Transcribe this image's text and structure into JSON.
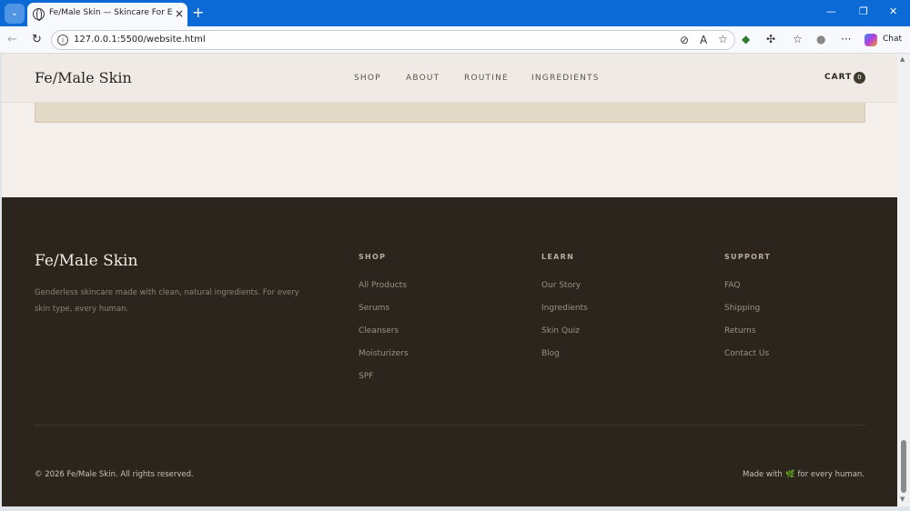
{
  "browser": {
    "tab_title": "Fe/Male Skin — Skincare For Every",
    "new_tab_icon": "plus-icon",
    "url": "127.0.0.1:5500/website.html",
    "chat_label": "Chat",
    "minimize": "—",
    "restore": "❐",
    "close": "✕"
  },
  "site": {
    "logo": "Fe/Male Skin",
    "nav": [
      "SHOP",
      "ABOUT",
      "ROUTINE",
      "INGREDIENTS"
    ],
    "cart_label": "CART",
    "cart_count": "0"
  },
  "footer": {
    "logo": "Fe/Male Skin",
    "tagline": "Genderless skincare made with clean, natural ingredients. For every skin type, every human.",
    "columns": [
      {
        "heading": "SHOP",
        "items": [
          "All Products",
          "Serums",
          "Cleansers",
          "Moisturizers",
          "SPF"
        ]
      },
      {
        "heading": "LEARN",
        "items": [
          "Our Story",
          "Ingredients",
          "Skin Quiz",
          "Blog"
        ]
      },
      {
        "heading": "SUPPORT",
        "items": [
          "FAQ",
          "Shipping",
          "Returns",
          "Contact Us"
        ]
      }
    ],
    "copyright": "© 2026 Fe/Male Skin. All rights reserved.",
    "made_with_prefix": "Made with",
    "made_with_suffix": "for every human."
  },
  "colors": {
    "footer_bg": "#2b251d",
    "page_bg": "#f4efea",
    "browser_accent": "#0b6ad6"
  }
}
